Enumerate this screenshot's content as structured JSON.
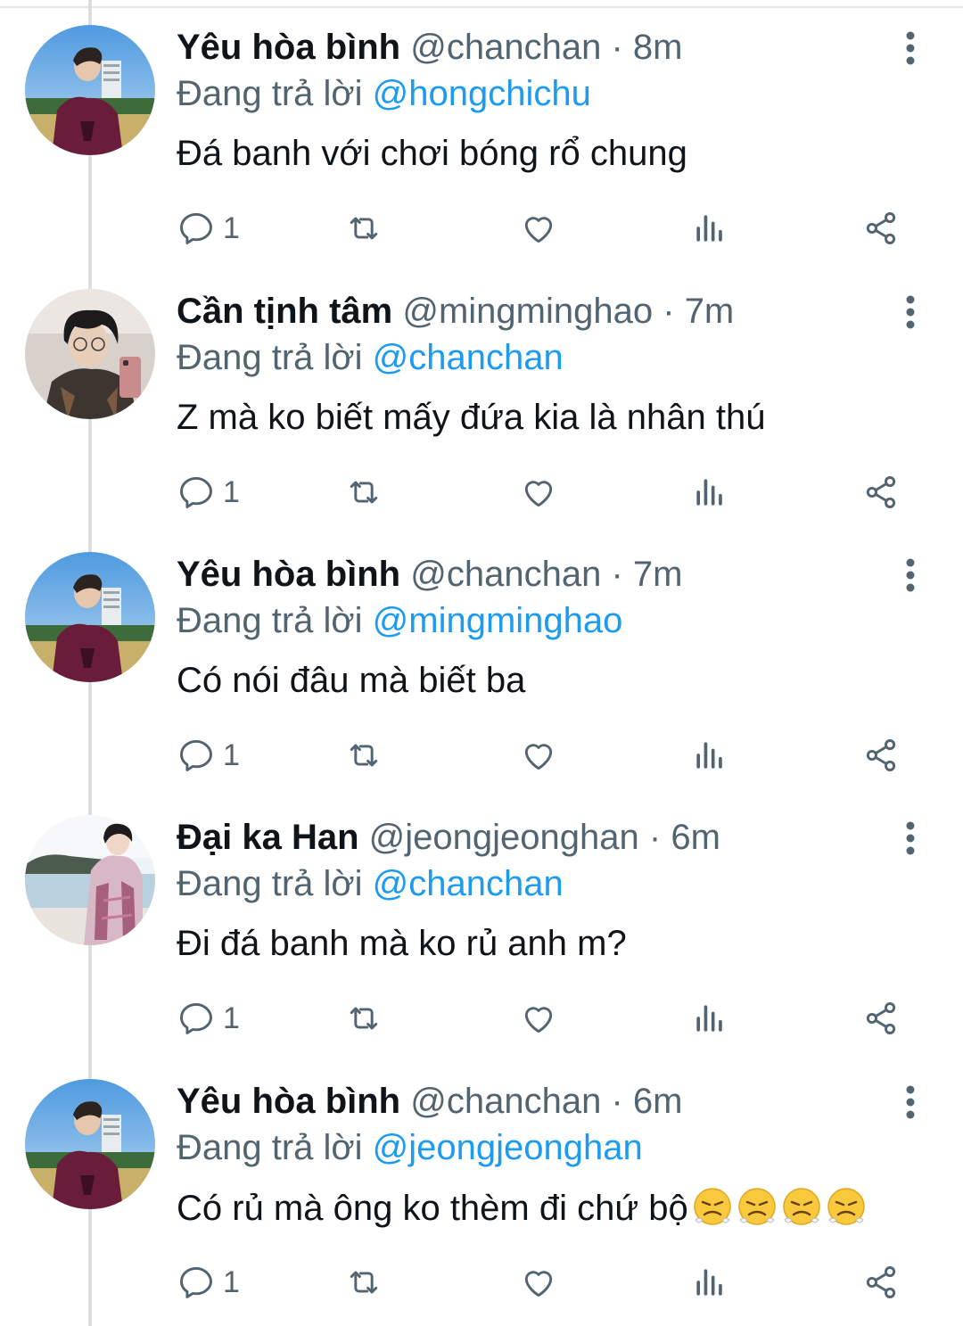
{
  "tweets": [
    {
      "name": "Yêu hòa bình",
      "handle": "@chanchan",
      "separator": "·",
      "time": "8m",
      "replying_label": "Đang trả lời",
      "replying_to": "@hongchichu",
      "text": "Đá banh với chơi bóng rổ chung",
      "reply_count": "1",
      "avatar": "avatar-chanchan"
    },
    {
      "name": "Cần tịnh tâm",
      "handle": "@mingminghao",
      "separator": "·",
      "time": "7m",
      "replying_label": "Đang trả lời",
      "replying_to": "@chanchan",
      "text": "Z mà ko biết mấy đứa kia là nhân thú",
      "reply_count": "1",
      "avatar": "avatar-mingminghao"
    },
    {
      "name": "Yêu hòa bình",
      "handle": "@chanchan",
      "separator": "·",
      "time": "7m",
      "replying_label": "Đang trả lời",
      "replying_to": "@mingminghao",
      "text": "Có nói đâu mà biết ba",
      "reply_count": "1",
      "avatar": "avatar-chanchan"
    },
    {
      "name": "Đại ka Han",
      "handle": "@jeongjeonghan",
      "separator": "·",
      "time": "6m",
      "replying_label": "Đang trả lời",
      "replying_to": "@chanchan",
      "text": "Đi đá banh mà ko rủ anh m?",
      "reply_count": "1",
      "avatar": "avatar-jeongjeonghan"
    },
    {
      "name": "Yêu hòa bình",
      "handle": "@chanchan",
      "separator": "·",
      "time": "6m",
      "replying_label": "Đang trả lời",
      "replying_to": "@jeongjeonghan",
      "text": "Có rủ mà ông ko thèm đi chứ bộ",
      "text_emoji": [
        "face-with-steam-from-nose",
        "face-with-steam-from-nose",
        "face-with-steam-from-nose",
        "face-with-steam-from-nose"
      ],
      "reply_count": "1",
      "avatar": "avatar-chanchan"
    }
  ],
  "icons": {
    "reply": "reply-icon",
    "retweet": "retweet-icon",
    "like": "heart-icon",
    "views": "views-icon",
    "share": "share-icon",
    "more": "more-vertical-icon"
  },
  "colors": {
    "text": "#0f1419",
    "secondary": "#536471",
    "link": "#1d9bf0",
    "thread_line": "#dcdfe2"
  }
}
